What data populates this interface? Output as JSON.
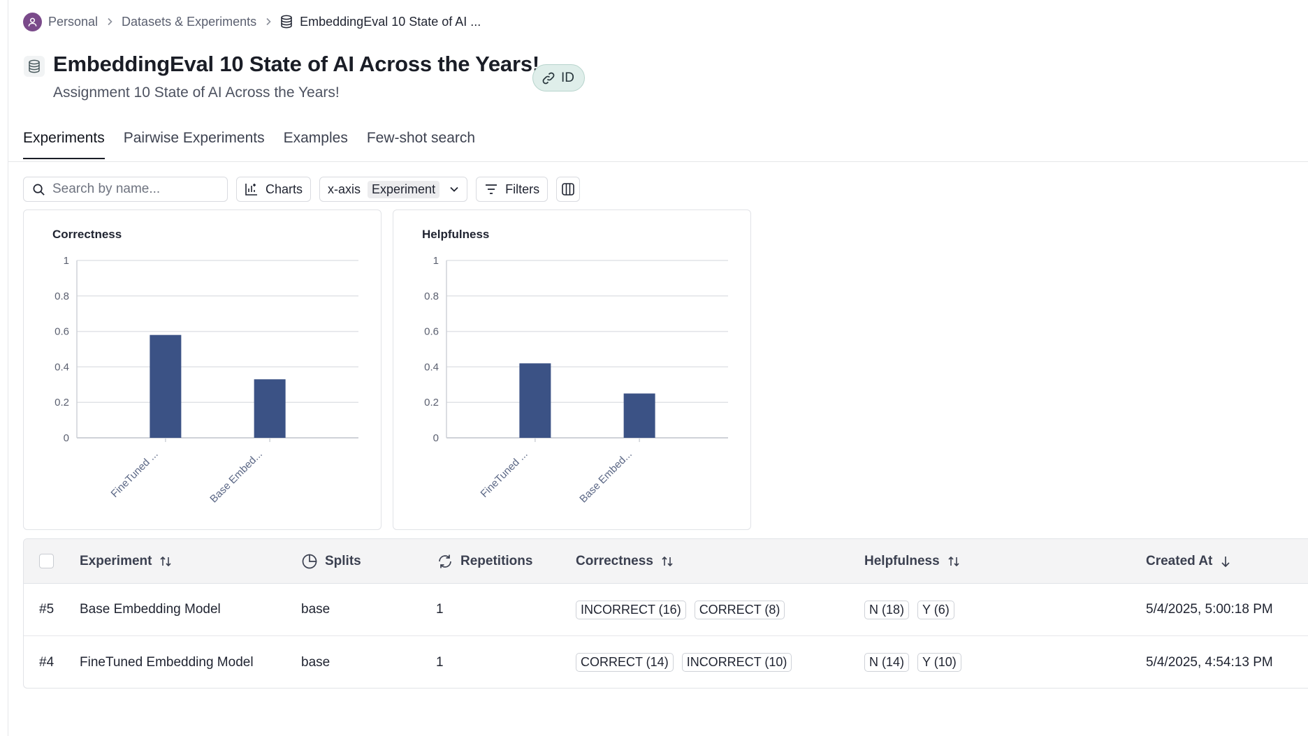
{
  "breadcrumb": {
    "items": [
      "Personal",
      "Datasets & Experiments"
    ],
    "current": "EmbeddingEval 10 State of AI ..."
  },
  "header": {
    "title": "EmbeddingEval 10 State of AI Across the Years!",
    "subtitle": "Assignment 10 State of AI Across the Years!",
    "id_label": "ID"
  },
  "tabs": [
    {
      "label": "Experiments",
      "active": true
    },
    {
      "label": "Pairwise Experiments",
      "active": false
    },
    {
      "label": "Examples",
      "active": false
    },
    {
      "label": "Few-shot search",
      "active": false
    }
  ],
  "toolbar": {
    "search_placeholder": "Search by name...",
    "charts_label": "Charts",
    "xaxis_label": "x-axis",
    "xaxis_value": "Experiment",
    "filters_label": "Filters"
  },
  "colors": {
    "bar": "#3b5285",
    "accent_pill": "#dfeeea"
  },
  "chart_data": [
    {
      "type": "bar",
      "title": "Correctness",
      "categories": [
        "FineTuned ...",
        "Base Embed..."
      ],
      "values": [
        0.58,
        0.33
      ],
      "ylim": [
        0,
        1
      ],
      "yticks": [
        "0",
        "0.2",
        "0.4",
        "0.6",
        "0.8",
        "1"
      ],
      "grid": true
    },
    {
      "type": "bar",
      "title": "Helpfulness",
      "categories": [
        "FineTuned ...",
        "Base Embed..."
      ],
      "values": [
        0.42,
        0.25
      ],
      "ylim": [
        0,
        1
      ],
      "yticks": [
        "0",
        "0.2",
        "0.4",
        "0.6",
        "0.8",
        "1"
      ],
      "grid": true
    }
  ],
  "table": {
    "columns": {
      "experiment": "Experiment",
      "splits": "Splits",
      "repetitions": "Repetitions",
      "correctness": "Correctness",
      "helpfulness": "Helpfulness",
      "created_at": "Created At"
    },
    "rows": [
      {
        "id": "#5",
        "experiment": "Base Embedding Model",
        "splits": "base",
        "repetitions": "1",
        "correctness": [
          "INCORRECT (16)",
          "CORRECT (8)"
        ],
        "helpfulness": [
          "N (18)",
          "Y (6)"
        ],
        "created_at": "5/4/2025, 5:00:18 PM"
      },
      {
        "id": "#4",
        "experiment": "FineTuned Embedding Model",
        "splits": "base",
        "repetitions": "1",
        "correctness": [
          "CORRECT (14)",
          "INCORRECT (10)"
        ],
        "helpfulness": [
          "N (14)",
          "Y (10)"
        ],
        "created_at": "5/4/2025, 4:54:13 PM"
      }
    ]
  }
}
